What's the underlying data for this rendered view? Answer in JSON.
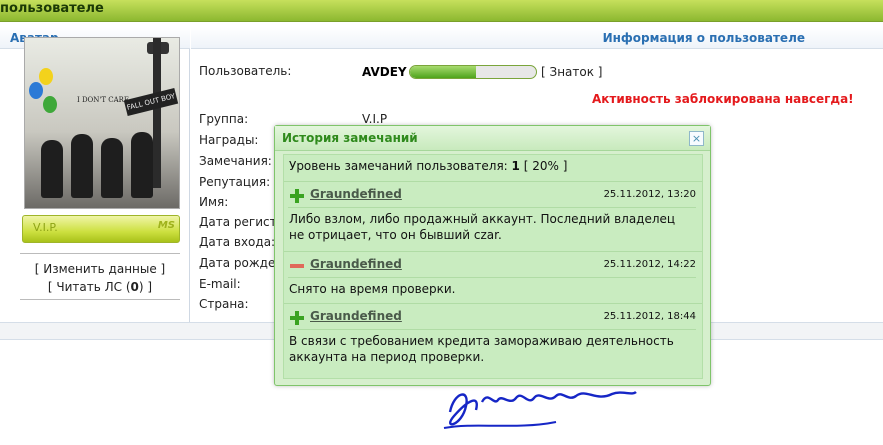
{
  "header": {
    "title": "пользователе"
  },
  "left_column": {
    "heading": "Аватар",
    "vip_badge": {
      "text": "V.I.P.",
      "logo": "MS"
    },
    "avatar_banner": "I DON'T CARE",
    "avatar_sign": "FALL OUT BOY",
    "links": [
      {
        "label": "[ Изменить данные ]"
      },
      {
        "prefix": "[ Читать ЛС (",
        "count": "0",
        "suffix": ") ]"
      }
    ]
  },
  "right_column": {
    "heading": "Информация о пользователе",
    "labels": [
      "Пользователь:",
      "Группа:",
      "Награды:",
      "Замечания:",
      "Репутация:",
      "Имя:",
      "Дата регистр",
      "Дата входа:",
      "Дата рожден",
      "E-mail:",
      "Страна:"
    ],
    "username": "AVDEY",
    "rank_progress": 0.52,
    "rank_label": "[ Знаток ]",
    "blocked_notice": "Активность заблокирована навсегда!",
    "group_value": "V.I.P"
  },
  "popup": {
    "title": "История замечаний",
    "close_icon": "×",
    "level_prefix": "Уровень замечаний пользователя: ",
    "level_value": "1",
    "level_suffix": " [ 20% ]",
    "entries": [
      {
        "type": "plus",
        "author": "Graundefined",
        "date": "25.11.2012, 13:20",
        "text": "Либо взлом, либо продажный аккаунт. Последний владелец не отрицает, что он бывший czar."
      },
      {
        "type": "minus",
        "author": "Graundefined",
        "date": "25.11.2012, 14:22",
        "text": "Снято на время проверки."
      },
      {
        "type": "plus",
        "author": "Graundefined",
        "date": "25.11.2012, 18:44",
        "text": "В связи с требованием кредита замораживаю деятельность аккаунта на период проверки."
      }
    ]
  },
  "colors": {
    "accent_blue": "#2a6fb2",
    "blocked_red": "#e4191c",
    "popup_green": "#2f8a1c",
    "plus_green": "#3aa321",
    "minus_red": "#e06a5a"
  }
}
